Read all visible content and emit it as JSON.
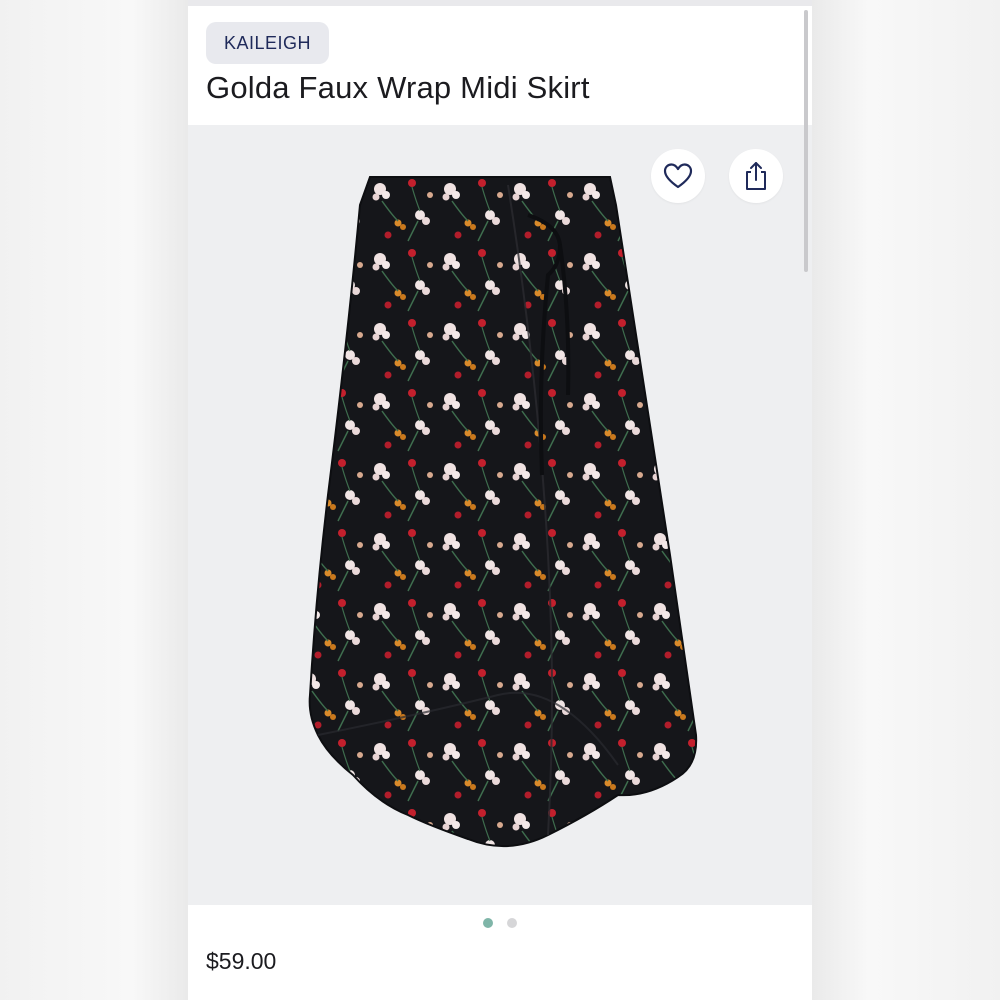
{
  "product": {
    "brand": "KAILEIGH",
    "name": "Golda Faux Wrap Midi Skirt",
    "price": "$59.00",
    "image_alt": "Black floral faux wrap midi skirt"
  },
  "actions": {
    "favorite_icon": "heart-icon",
    "share_icon": "share-icon"
  },
  "carousel": {
    "total": 2,
    "active_index": 0
  },
  "colors": {
    "accent_dot": "#7fb5a8",
    "brand_chip_bg": "#e8e9ee",
    "brand_text": "#1f2a5a"
  }
}
